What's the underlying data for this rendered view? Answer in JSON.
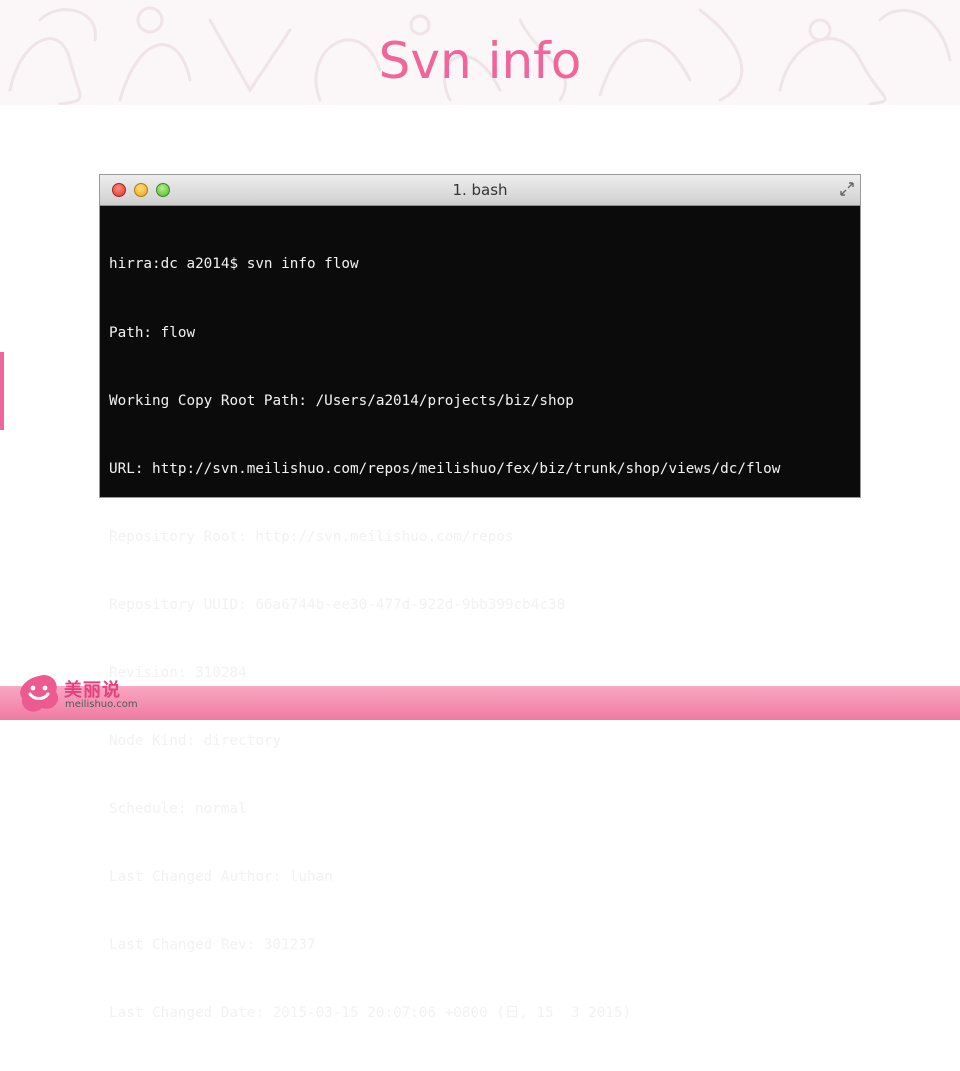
{
  "slide": {
    "title": "Svn info"
  },
  "terminal": {
    "window_title": "1. bash",
    "lines": [
      "hirra:dc a2014$ svn info flow",
      "Path: flow",
      "Working Copy Root Path: /Users/a2014/projects/biz/shop",
      "URL: http://svn.meilishuo.com/repos/meilishuo/fex/biz/trunk/shop/views/dc/flow",
      "Repository Root: http://svn.meilishuo.com/repos",
      "Repository UUID: 66a6744b-ee30-477d-922d-9bb399cb4c38",
      "Revision: 310284",
      "Node Kind: directory",
      "Schedule: normal",
      "Last Changed Author: luhan",
      "Last Changed Rev: 301237",
      "Last Changed Date: 2015-03-15 20:07:06 +0800 (日, 15  3 2015)"
    ]
  },
  "logo": {
    "name_cn": "美丽说",
    "url": "meilishuo.com"
  },
  "colors": {
    "title": "#f0669a",
    "footer": "#f07aa2",
    "terminal_bg": "#0b0b0b",
    "terminal_text": "#f2f2f2"
  }
}
